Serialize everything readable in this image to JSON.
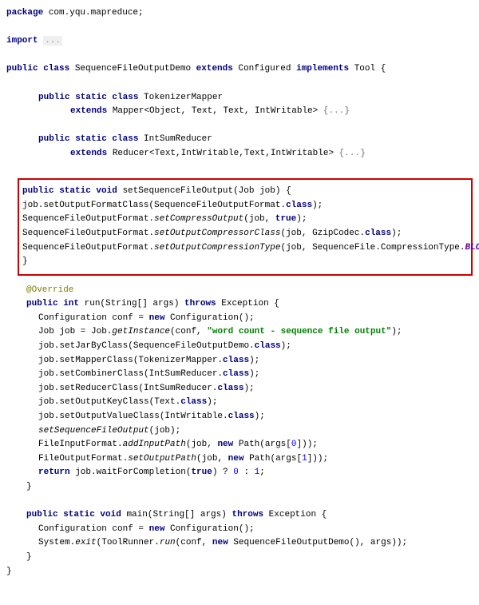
{
  "code": {
    "l1_kw1": "package",
    "l1_pkg": " com.yqu.mapreduce;",
    "l2_kw1": "import",
    "l2_fold": "...",
    "l3_kw1": "public",
    "l3_kw2": " class",
    "l3_name": " SequenceFileOutputDemo ",
    "l3_kw3": "extends",
    "l3_ext": " Configured ",
    "l3_kw4": "implements",
    "l3_impl": " Tool {",
    "l4_kw1": "public",
    "l4_kw2": " static",
    "l4_kw3": " class",
    "l4_name": " TokenizerMapper",
    "l5_kw1": "extends",
    "l5_ext": " Mapper<Object, Text, Text, IntWritable> ",
    "l5_fold": "{...}",
    "l6_kw1": "public",
    "l6_kw2": " static",
    "l6_kw3": " class",
    "l6_name": " IntSumReducer",
    "l7_kw1": "extends",
    "l7_ext": " Reducer<Text,IntWritable,Text,IntWritable> ",
    "l7_fold": "{...}",
    "h1_kw1": "public",
    "h1_kw2": " static",
    "h1_kw3": " void",
    "h1_name": " setSequenceFileOutput(Job job) {",
    "h2_a": "    job.setOutputFormatClass(SequenceFileOutputFormat.",
    "h2_kw": "class",
    "h2_b": ");",
    "h3_a": "    SequenceFileOutputFormat.",
    "h3_m": "setCompressOutput",
    "h3_b": "(job, ",
    "h3_kw": "true",
    "h3_c": ");",
    "h4_a": "    SequenceFileOutputFormat.",
    "h4_m": "setOutputCompressorClass",
    "h4_b": "(job, GzipCodec.",
    "h4_kw": "class",
    "h4_c": ");",
    "h5_a": "    SequenceFileOutputFormat.",
    "h5_m": "setOutputCompressionType",
    "h5_b": "(job, SequenceFile.CompressionType.",
    "h5_enum": "BLOCK",
    "h5_c": ");",
    "h6": "}",
    "ann": "@Override",
    "r1_kw1": "public",
    "r1_kw2": " int",
    "r1_name": " run(String[] args) ",
    "r1_kw3": "throws",
    "r1_end": " Exception {",
    "r2_a": "Configuration conf = ",
    "r2_kw": "new",
    "r2_b": " Configuration();",
    "r3_a": "Job job = Job.",
    "r3_m": "getInstance",
    "r3_b": "(conf, ",
    "r3_str": "\"word count - sequence file output\"",
    "r3_c": ");",
    "r4_a": "job.setJarByClass(SequenceFileOutputDemo.",
    "r4_kw": "class",
    "r4_b": ");",
    "r5_a": "job.setMapperClass(TokenizerMapper.",
    "r5_kw": "class",
    "r5_b": ");",
    "r6_a": "job.setCombinerClass(IntSumReducer.",
    "r6_kw": "class",
    "r6_b": ");",
    "r7_a": "job.setReducerClass(IntSumReducer.",
    "r7_kw": "class",
    "r7_b": ");",
    "r8_a": "job.setOutputKeyClass(Text.",
    "r8_kw": "class",
    "r8_b": ");",
    "r9_a": "job.setOutputValueClass(IntWritable.",
    "r9_kw": "class",
    "r9_b": ");",
    "r10": "setSequenceFileOutput",
    "r10_b": "(job);",
    "r11_a": "FileInputFormat.",
    "r11_m": "addInputPath",
    "r11_b": "(job, ",
    "r11_kw": "new",
    "r11_c": " Path(args[",
    "r11_n": "0",
    "r11_d": "]));",
    "r12_a": "FileOutputFormat.",
    "r12_m": "setOutputPath",
    "r12_b": "(job, ",
    "r12_kw": "new",
    "r12_c": " Path(args[",
    "r12_n": "1",
    "r12_d": "]));",
    "r13_kw": "return",
    "r13_a": " job.waitForCompletion(",
    "r13_kw2": "true",
    "r13_b": ") ? ",
    "r13_n1": "0",
    "r13_c": " : ",
    "r13_n2": "1",
    "r13_d": ";",
    "r14": "}",
    "m1_kw1": "public",
    "m1_kw2": " static",
    "m1_kw3": " void",
    "m1_name": " main(String[] args) ",
    "m1_kw4": "throws",
    "m1_end": " Exception {",
    "m2_a": "Configuration conf = ",
    "m2_kw": "new",
    "m2_b": " Configuration();",
    "m3_a": "System.",
    "m3_m1": "exit",
    "m3_b": "(ToolRunner.",
    "m3_m2": "run",
    "m3_c": "(conf, ",
    "m3_kw": "new",
    "m3_d": " SequenceFileOutputDemo(), args));",
    "m4": "}",
    "end": "}"
  }
}
